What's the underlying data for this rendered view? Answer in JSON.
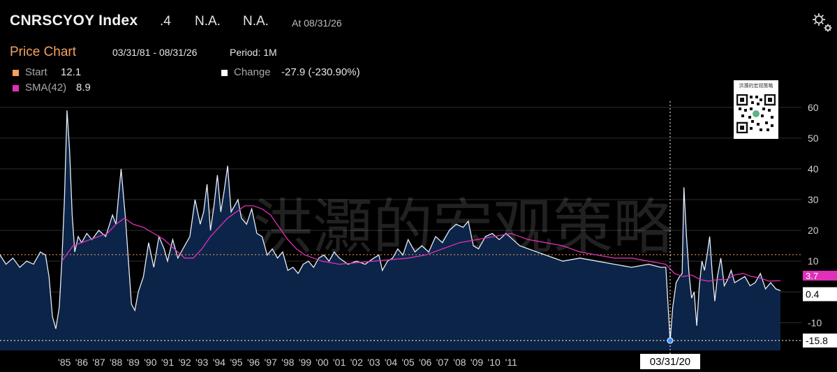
{
  "header": {
    "ticker": "CNRSCYOY Index",
    "last_value": ".4",
    "field2": "N.A.",
    "field3": "N.A.",
    "as_of": "At 08/31/26"
  },
  "toolbar": {
    "settings_icon": "gear-icon"
  },
  "chart_header": {
    "title": "Price Chart",
    "date_range": "03/31/81 - 08/31/26",
    "period": "Period: 1M"
  },
  "legend": {
    "start_label": "Start",
    "start_value": "12.1",
    "sma_label": "SMA(42)",
    "sma_value": "8.9",
    "change_label": "Change",
    "change_value": "-27.9 (-230.90%)"
  },
  "watermark": "@洪灝的宏观策略",
  "qr_caption": "洪灝的宏观策略",
  "colors": {
    "background": "#000000",
    "area_fill": "#0c2448",
    "price_line": "#e8eef7",
    "sma_line": "#e030b8",
    "start_marker": "#f5a25d",
    "grid": "#2e2e2e"
  },
  "chart_data": {
    "type": "area",
    "title": "Price Chart",
    "ylim": [
      -19,
      62
    ],
    "xlim": [
      1981.25,
      2026.67
    ],
    "y_ticks": [
      60,
      50,
      40,
      30,
      20,
      10,
      0,
      -10
    ],
    "x_tick_labels": [
      "'85",
      "'86",
      "'87",
      "'88",
      "'89",
      "'90",
      "'91",
      "'92",
      "'93",
      "'94",
      "'95",
      "'96",
      "'97",
      "'98",
      "'99",
      "'00",
      "'01",
      "'02",
      "'03",
      "'04",
      "'05",
      "'06",
      "'07",
      "'08",
      "'09",
      "'10",
      "'11"
    ],
    "x_tick_years": [
      1985,
      1986,
      1987,
      1988,
      1989,
      1990,
      1991,
      1992,
      1993,
      1994,
      1995,
      1996,
      1997,
      1998,
      1999,
      2000,
      2001,
      2002,
      2003,
      2004,
      2005,
      2006,
      2007,
      2008,
      2009,
      2010,
      2011
    ],
    "grid": true,
    "start_level": 12.1,
    "crosshair": {
      "label": "03/31/20",
      "x": 2020.25,
      "y": -15.8,
      "value_label": "-15.8"
    },
    "last_value_label": "0.4",
    "sma_last_label": "3.7",
    "series": [
      {
        "name": "Price",
        "x": [
          1981.25,
          1981.6,
          1982.0,
          1982.4,
          1982.8,
          1983.2,
          1983.6,
          1983.9,
          1984.1,
          1984.3,
          1984.5,
          1984.7,
          1984.85,
          1985.0,
          1985.15,
          1985.3,
          1985.45,
          1985.6,
          1985.8,
          1986.0,
          1986.3,
          1986.6,
          1987.0,
          1987.4,
          1987.8,
          1988.0,
          1988.3,
          1988.55,
          1988.7,
          1988.9,
          1989.1,
          1989.3,
          1989.6,
          1989.9,
          1990.2,
          1990.5,
          1990.8,
          1991.0,
          1991.3,
          1991.6,
          1992.0,
          1992.3,
          1992.6,
          1992.9,
          1993.1,
          1993.3,
          1993.5,
          1993.7,
          1993.9,
          1994.1,
          1994.3,
          1994.5,
          1994.7,
          1994.9,
          1995.1,
          1995.3,
          1995.6,
          1995.9,
          1996.2,
          1996.5,
          1996.8,
          1997.1,
          1997.4,
          1997.7,
          1998.0,
          1998.3,
          1998.6,
          1998.9,
          1999.2,
          1999.5,
          1999.8,
          2000.1,
          2000.4,
          2000.7,
          2001.0,
          2001.5,
          2002.0,
          2002.5,
          2003.0,
          2003.3,
          2003.5,
          2003.8,
          2004.1,
          2004.4,
          2004.7,
          2005.0,
          2005.4,
          2005.8,
          2006.2,
          2006.6,
          2007.0,
          2007.4,
          2007.8,
          2008.2,
          2008.5,
          2008.8,
          2009.1,
          2009.5,
          2009.9,
          2010.3,
          2010.7,
          2011.1,
          2011.5,
          2012.0,
          2013.0,
          2014.0,
          2015.0,
          2016.0,
          2017.0,
          2018.0,
          2019.0,
          2019.7,
          2020.0,
          2020.25,
          2020.4,
          2020.6,
          2020.8,
          2020.95,
          2021.05,
          2021.2,
          2021.35,
          2021.5,
          2021.65,
          2021.8,
          2021.95,
          2022.1,
          2022.25,
          2022.4,
          2022.55,
          2022.7,
          2022.85,
          2023.0,
          2023.2,
          2023.4,
          2023.6,
          2023.8,
          2024.0,
          2024.3,
          2024.6,
          2024.9,
          2025.2,
          2025.5,
          2025.8,
          2026.1,
          2026.4,
          2026.67
        ],
        "y": [
          12,
          9,
          11,
          8,
          10,
          9,
          13,
          12,
          5,
          -8,
          -12,
          -5,
          10,
          30,
          59,
          46,
          25,
          13,
          18,
          16,
          19,
          17,
          20,
          18,
          25,
          22,
          40,
          24,
          12,
          -4,
          -6,
          0,
          5,
          16,
          8,
          18,
          14,
          10,
          17,
          11,
          15,
          18,
          30,
          22,
          26,
          35,
          20,
          28,
          38,
          26,
          33,
          41,
          26,
          28,
          30,
          24,
          22,
          27,
          19,
          18,
          12,
          14,
          11,
          13,
          7,
          8,
          6,
          9,
          10,
          8,
          11,
          12,
          10,
          13,
          11,
          9,
          10,
          9,
          11,
          12,
          7,
          10,
          11,
          14,
          12,
          17,
          13,
          15,
          13,
          18,
          16,
          20,
          22,
          21,
          23,
          15,
          14,
          18,
          19,
          17,
          19,
          17,
          15,
          14,
          12,
          10,
          11,
          10,
          9,
          8,
          9,
          8,
          8,
          -16,
          -5,
          3,
          5,
          6,
          34,
          18,
          6,
          -2,
          0,
          -11,
          2,
          10,
          7,
          12,
          18,
          6,
          -3,
          5,
          11,
          2,
          4,
          7,
          3,
          4,
          5,
          2,
          3,
          6,
          1,
          3,
          1,
          0.4
        ]
      },
      {
        "name": "SMA(42)",
        "x": [
          1984.85,
          1985.5,
          1986.5,
          1987.5,
          1988.0,
          1988.5,
          1989.0,
          1989.6,
          1990.2,
          1990.8,
          1991.4,
          1992.0,
          1992.5,
          1993.0,
          1993.5,
          1994.0,
          1994.5,
          1995.0,
          1995.5,
          1996.0,
          1996.5,
          1997.0,
          1997.5,
          1998.0,
          1998.5,
          1999.0,
          1999.5,
          2000.0,
          2000.5,
          2001.0,
          2002.0,
          2003.0,
          2004.0,
          2005.0,
          2006.0,
          2007.0,
          2008.0,
          2009.0,
          2010.0,
          2011.0,
          2012.0,
          2013.0,
          2014.0,
          2015.0,
          2016.0,
          2017.0,
          2018.0,
          2019.0,
          2020.0,
          2020.5,
          2021.0,
          2021.5,
          2022.0,
          2022.5,
          2023.0,
          2023.5,
          2024.0,
          2024.5,
          2025.0,
          2025.5,
          2026.0,
          2026.67
        ],
        "y": [
          10,
          15,
          17,
          19,
          22,
          24,
          22,
          21,
          19,
          17,
          14,
          11,
          11,
          14,
          18,
          21,
          24,
          26,
          28,
          28,
          27,
          25,
          21,
          17,
          14,
          12,
          11,
          10,
          9.5,
          9,
          9.5,
          10,
          10.5,
          11,
          12,
          14,
          16,
          17,
          18,
          19,
          17,
          16,
          15,
          13,
          12,
          11,
          11,
          10,
          9,
          6,
          5,
          5.5,
          4,
          3.5,
          4,
          4,
          5.5,
          6,
          5,
          4.5,
          3.5,
          3.7
        ]
      }
    ]
  }
}
